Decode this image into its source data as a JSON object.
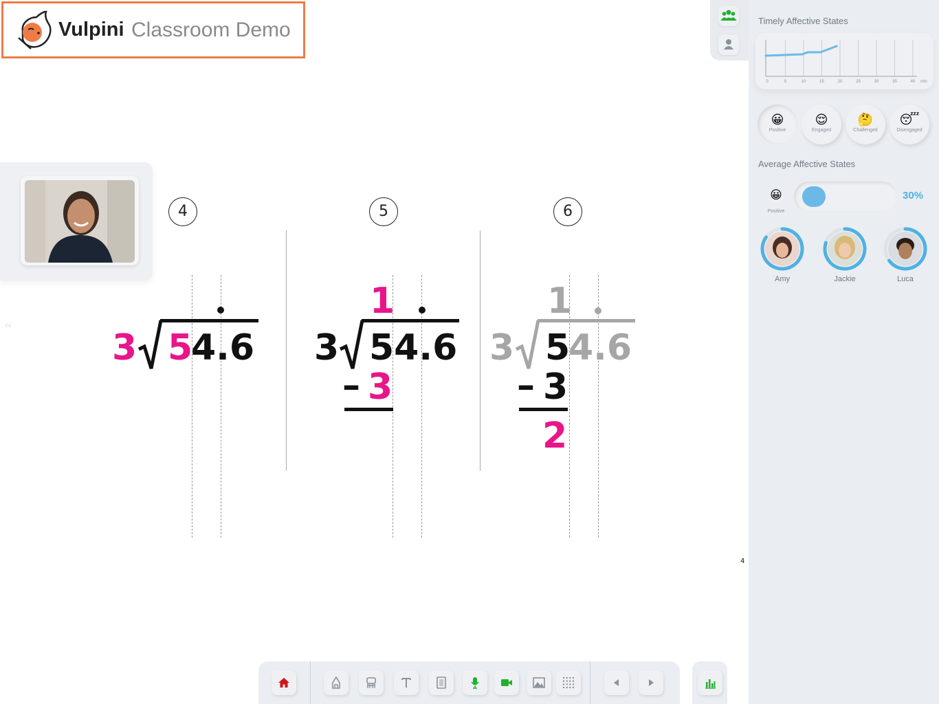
{
  "header": {
    "brand_name": "Vulpini",
    "subtitle": "Classroom Demo",
    "accent_color": "#ee7c45"
  },
  "canvas": {
    "collapse_hint": "‹‹",
    "page_number": "4",
    "colors": {
      "highlight": "#e8158b",
      "text": "#111111",
      "faded": "#a6a6a6"
    },
    "steps": [
      {
        "number": "4",
        "divisor": "3",
        "dividend_hl": "5",
        "dividend_rest": "4.6"
      },
      {
        "number": "5",
        "quotient": "1",
        "divisor": "3",
        "dividend": "54.6",
        "minus": "–",
        "subtrahend": "3"
      },
      {
        "number": "6",
        "quotient": "1",
        "divisor": "3",
        "dividend_first": "5",
        "dividend_rest": "4.6",
        "minus": "–",
        "subtrahend": "3",
        "remainder": "2"
      }
    ]
  },
  "right_panel": {
    "timely_title": "Timely Affective States",
    "timeline": {
      "ticks": [
        "0",
        "5",
        "10",
        "15",
        "20",
        "25",
        "30",
        "35",
        "40"
      ],
      "unit": "min",
      "line_color": "#6cb9e8"
    },
    "states": [
      {
        "label": "Positive",
        "icon": "grinning-face",
        "emoji": "😀"
      },
      {
        "label": "Engaged",
        "icon": "relieved-face",
        "emoji": "😌"
      },
      {
        "label": "Challenged",
        "icon": "thinking-face",
        "emoji": "🤔"
      },
      {
        "label": "Disengaged",
        "icon": "sleepy-face",
        "emoji": "😴"
      }
    ],
    "average_title": "Average Affective States",
    "average": {
      "state_label": "Positive",
      "emoji": "😀",
      "value_text": "30%",
      "fraction": 0.3
    },
    "students": [
      {
        "name": "Amy",
        "engagement": 0.85
      },
      {
        "name": "Jackie",
        "engagement": 0.8
      },
      {
        "name": "Luca",
        "engagement": 0.65
      }
    ],
    "ring_color": "#4fb1e3"
  },
  "toolbar": {
    "items": [
      "home-icon",
      "pen-icon",
      "eraser-icon",
      "text-icon",
      "page-icon",
      "microphone-icon",
      "video-camera-icon",
      "image-icon",
      "grid-icon",
      "previous-icon",
      "next-icon"
    ],
    "stats": "bar-chart-icon"
  }
}
